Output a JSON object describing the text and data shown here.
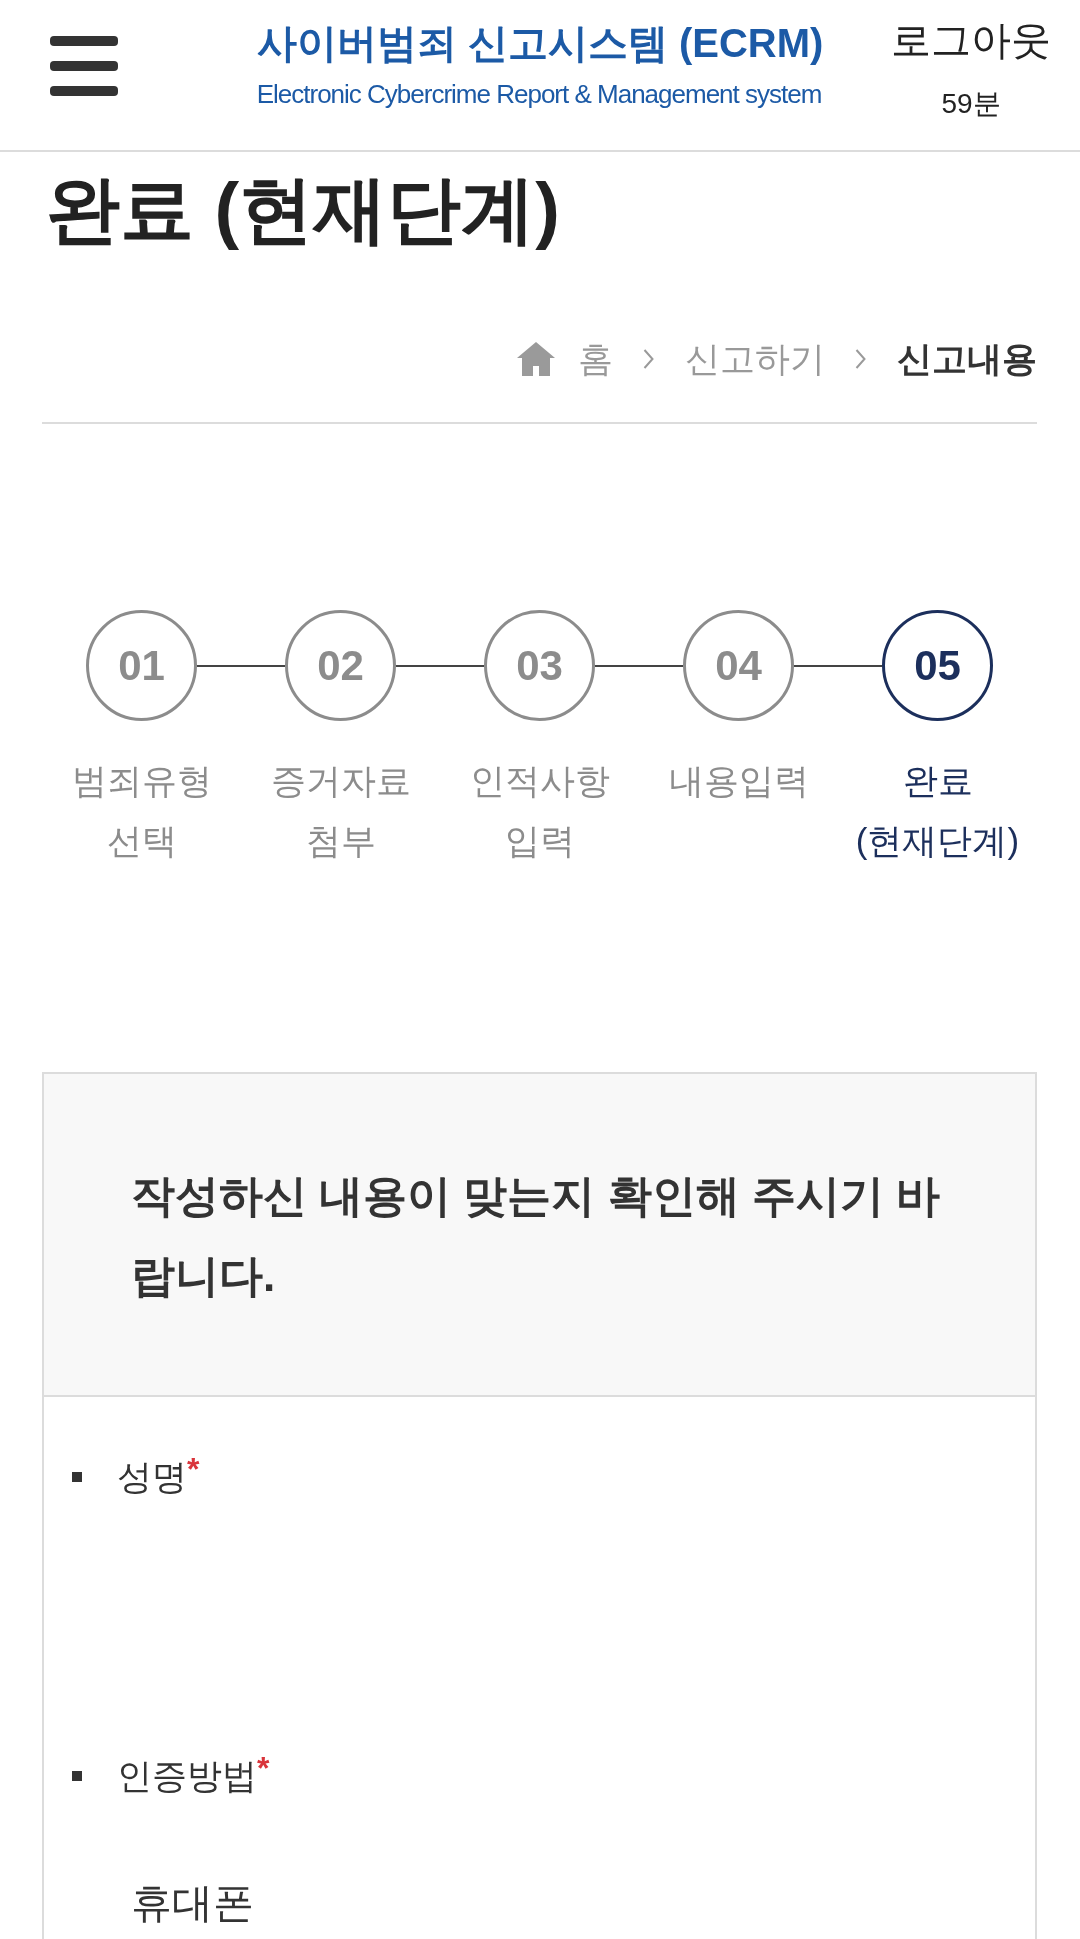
{
  "header": {
    "title": "사이버범죄 신고시스템 (ECRM)",
    "subtitle": "Electronic Cybercrime Report & Management system",
    "logout": "로그아웃",
    "session_time": "59분"
  },
  "page_title": "완료 (현재단계)",
  "breadcrumb": [
    {
      "kind": "home",
      "label": "홈"
    },
    {
      "kind": "link",
      "label": "신고하기"
    },
    {
      "kind": "current",
      "label": "신고내용"
    }
  ],
  "steps": [
    {
      "number": "01",
      "label": "범죄유형 선택",
      "selected": false
    },
    {
      "number": "02",
      "label": "증거자료 첨부",
      "selected": false
    },
    {
      "number": "03",
      "label": "인적사항 입력",
      "selected": false
    },
    {
      "number": "04",
      "label": "내용입력",
      "selected": false
    },
    {
      "number": "05",
      "label": "완료 (현재단계)",
      "selected": true
    }
  ],
  "summary": {
    "notice": "작성하신 내용이 맞는지 확인해 주시기 바랍니다.",
    "fields": [
      {
        "label": "성명",
        "required_mark": "*"
      },
      {
        "label": "인증방법",
        "required_mark": "*",
        "value": "휴대폰"
      }
    ]
  }
}
